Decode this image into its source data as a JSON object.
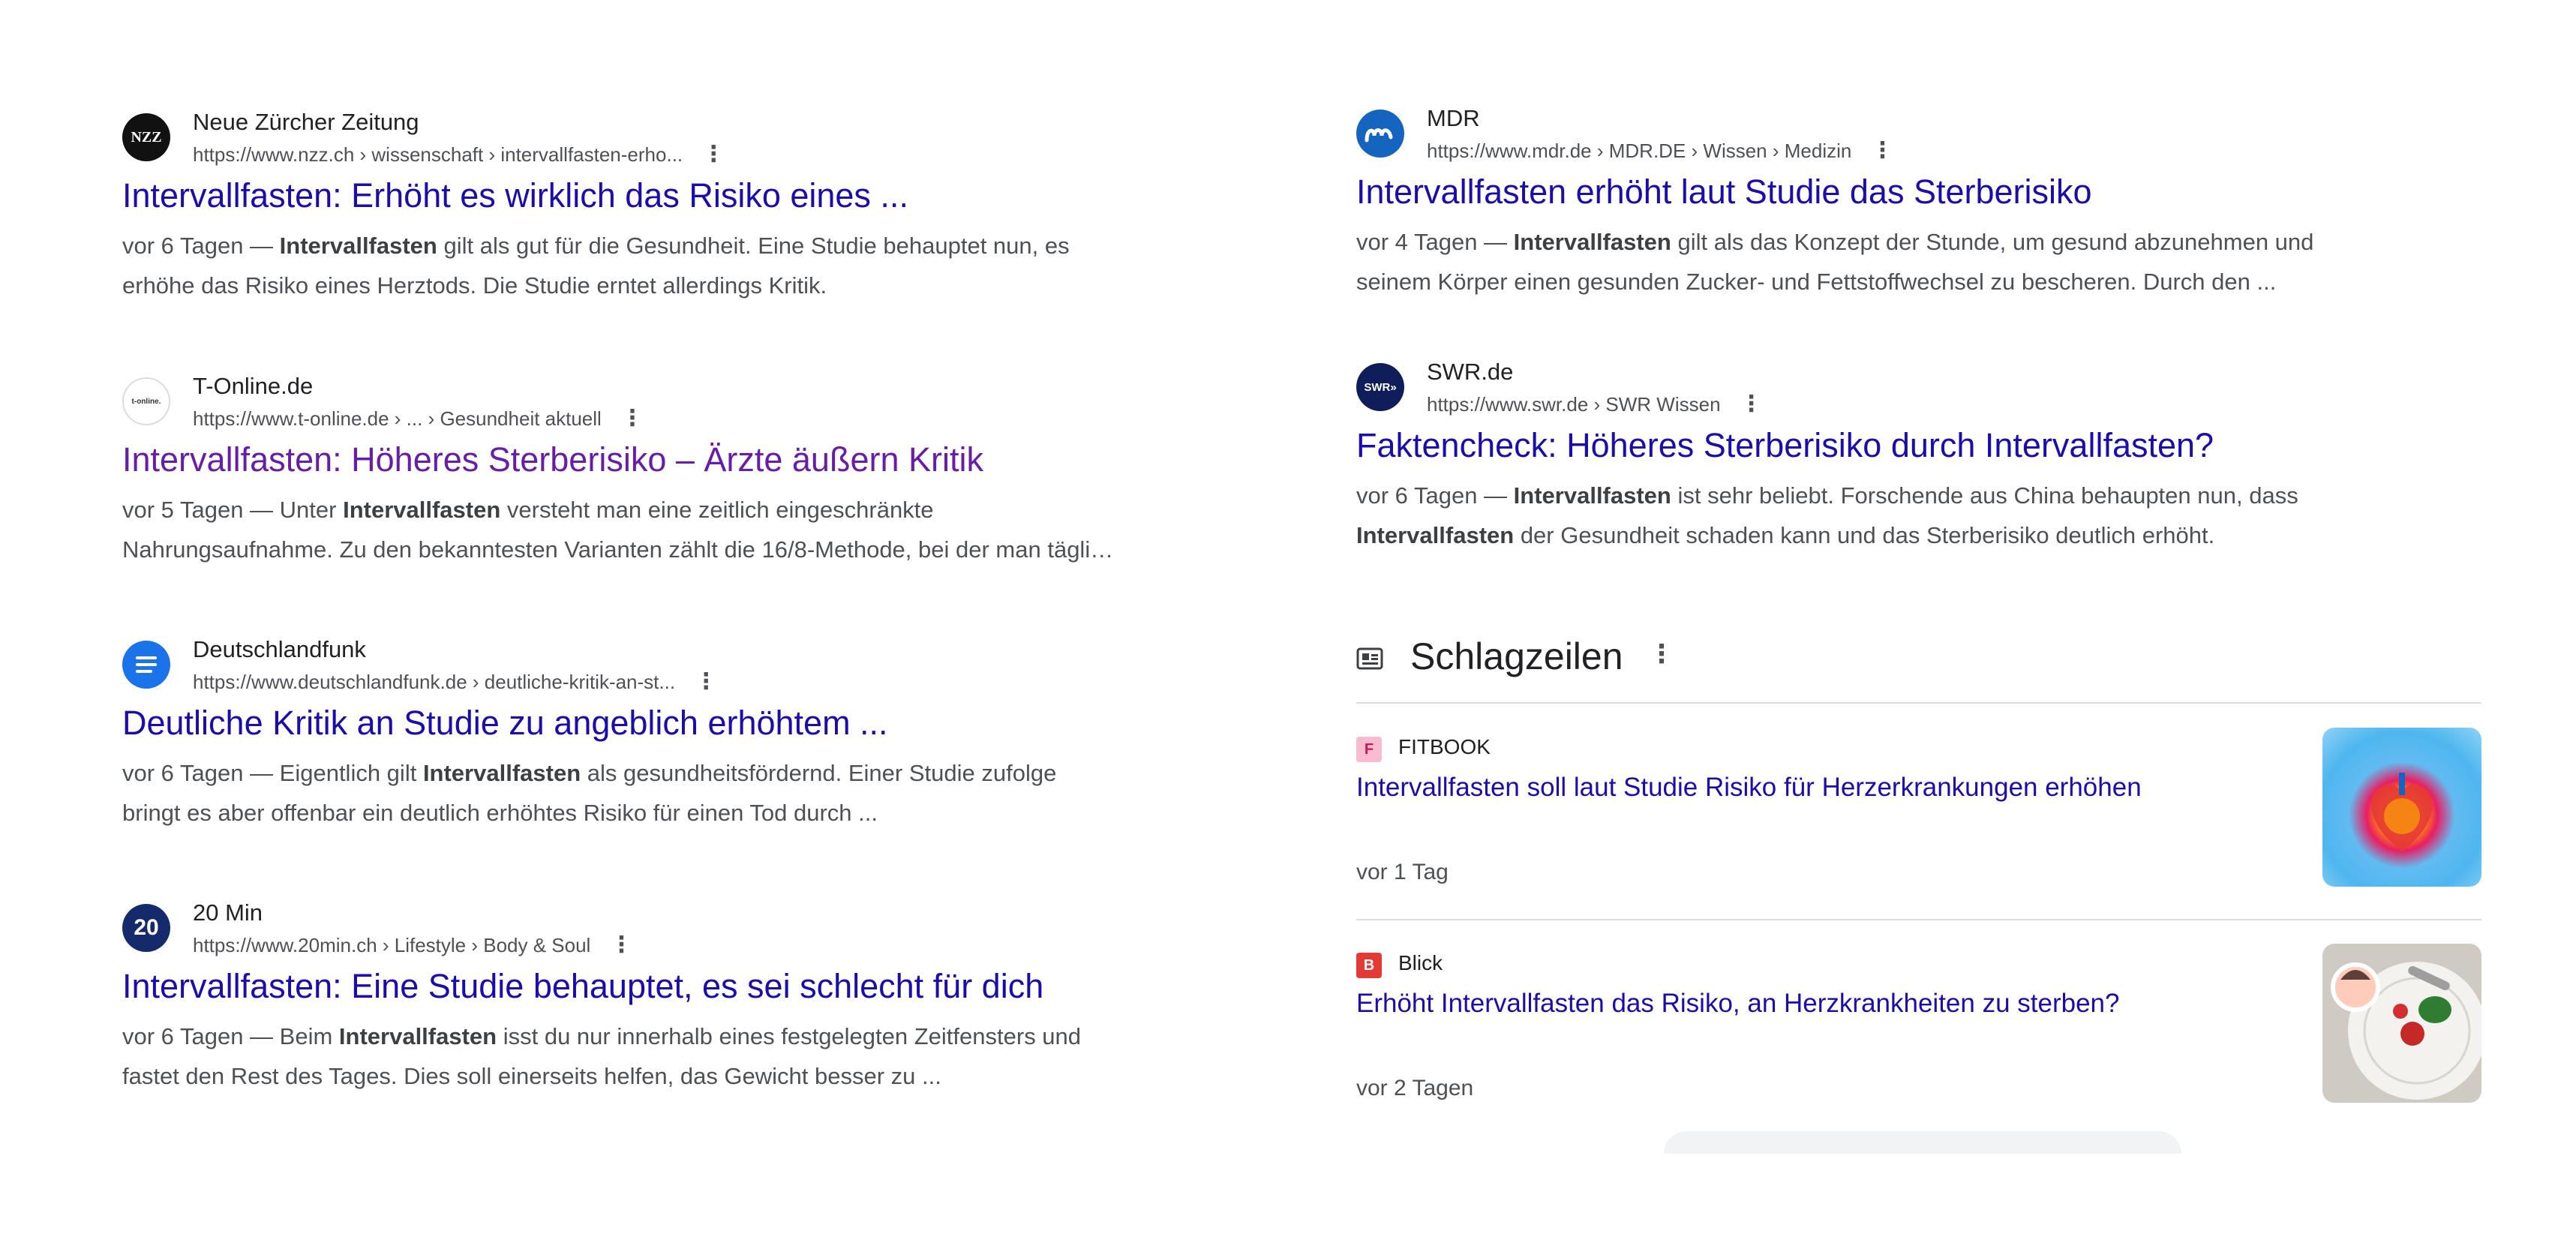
{
  "left_results": [
    {
      "source": "Neue Zürcher Zeitung",
      "url": "https://www.nzz.ch › wissenschaft › intervallfasten-erho...",
      "favicon_text": "NZZ",
      "title": "Intervallfasten: Erhöht es wirklich das Risiko eines ...",
      "snippet": {
        "l1_pre": "vor 6 Tagen — ",
        "l1_bold": "Intervallfasten",
        "l1_post": " gilt als gut für die Gesundheit. Eine Studie behauptet nun, es",
        "l2": "erhöhe das Risiko eines Herztods. Die Studie erntet allerdings Kritik."
      }
    },
    {
      "source": "T-Online.de",
      "url": "https://www.t-online.de › ... › Gesundheit aktuell",
      "favicon_text": "t-online.",
      "title": "Intervallfasten: Höheres Sterberisiko – Ärzte äußern Kritik",
      "snippet": {
        "l1_pre": "vor 5 Tagen — Unter ",
        "l1_bold": "Intervallfasten",
        "l1_post": " versteht man eine zeitlich eingeschränkte",
        "l2": "Nahrungsaufnahme. Zu den bekanntesten Varianten zählt die 16/8-Methode, bei der man tägli…"
      }
    },
    {
      "source": "Deutschlandfunk",
      "url": "https://www.deutschlandfunk.de › deutliche-kritik-an-st...",
      "title": "Deutliche Kritik an Studie zu angeblich erhöhtem ...",
      "snippet": {
        "l1_pre": "vor 6 Tagen — Eigentlich gilt ",
        "l1_bold": "Intervallfasten",
        "l1_post": " als gesundheitsfördernd. Einer Studie zufolge",
        "l2": "bringt es aber offenbar ein deutlich erhöhtes Risiko für einen Tod durch ..."
      }
    },
    {
      "source": "20 Min",
      "url": "https://www.20min.ch › Lifestyle › Body & Soul",
      "favicon_text": "20",
      "title": "Intervallfasten: Eine Studie behauptet, es sei schlecht für dich",
      "snippet": {
        "l1_pre": "vor 6 Tagen — Beim ",
        "l1_bold": "Intervallfasten",
        "l1_post": " isst du nur innerhalb eines festgelegten Zeitfensters und",
        "l2": "fastet den Rest des Tages. Dies soll einerseits helfen, das Gewicht besser zu ..."
      }
    }
  ],
  "right_results": [
    {
      "source": "MDR",
      "url": "https://www.mdr.de › MDR.DE › Wissen › Medizin",
      "title": "Intervallfasten erhöht laut Studie das Sterberisiko",
      "snippet": {
        "l1_pre": "vor 4 Tagen — ",
        "l1_bold": "Intervallfasten",
        "l1_post": " gilt als das Konzept der Stunde, um gesund abzunehmen und",
        "l2": "seinem Körper einen gesunden Zucker- und Fettstoffwechsel zu bescheren. Durch den ..."
      }
    },
    {
      "source": "SWR.de",
      "url": "https://www.swr.de › SWR Wissen",
      "favicon_text": "SWR»",
      "title": "Faktencheck: Höheres Sterberisiko durch Intervallfasten?",
      "snippet": {
        "l1_pre": "vor 6 Tagen — ",
        "l1_bold": "Intervallfasten",
        "l1_post": " ist sehr beliebt. Forschende aus China behaupten nun, dass",
        "l2_bold": "Intervallfasten",
        "l2_post": " der Gesundheit schaden kann und das Sterberisiko deutlich erhöht."
      }
    }
  ],
  "headlines": {
    "title": "Schlagzeilen",
    "stories": [
      {
        "source": "FITBOOK",
        "logo_text": "F",
        "title": "Intervallfasten soll laut Studie Risiko für Herzerkrankungen erhöhen",
        "time": "vor 1 Tag"
      },
      {
        "source": "Blick",
        "logo_text": "B",
        "title": "Erhöht Intervallfasten das Risiko, an Herzkrankheiten zu sterben?",
        "time": "vor 2 Tagen"
      }
    ]
  },
  "colors": {
    "link": "#1a0dab",
    "visited_link": "#681da8",
    "snippet_text": "#4d5156",
    "divider": "#dadce0"
  },
  "icons": {
    "more_options": "more-vert-icon",
    "headlines": "newspaper-icon"
  }
}
